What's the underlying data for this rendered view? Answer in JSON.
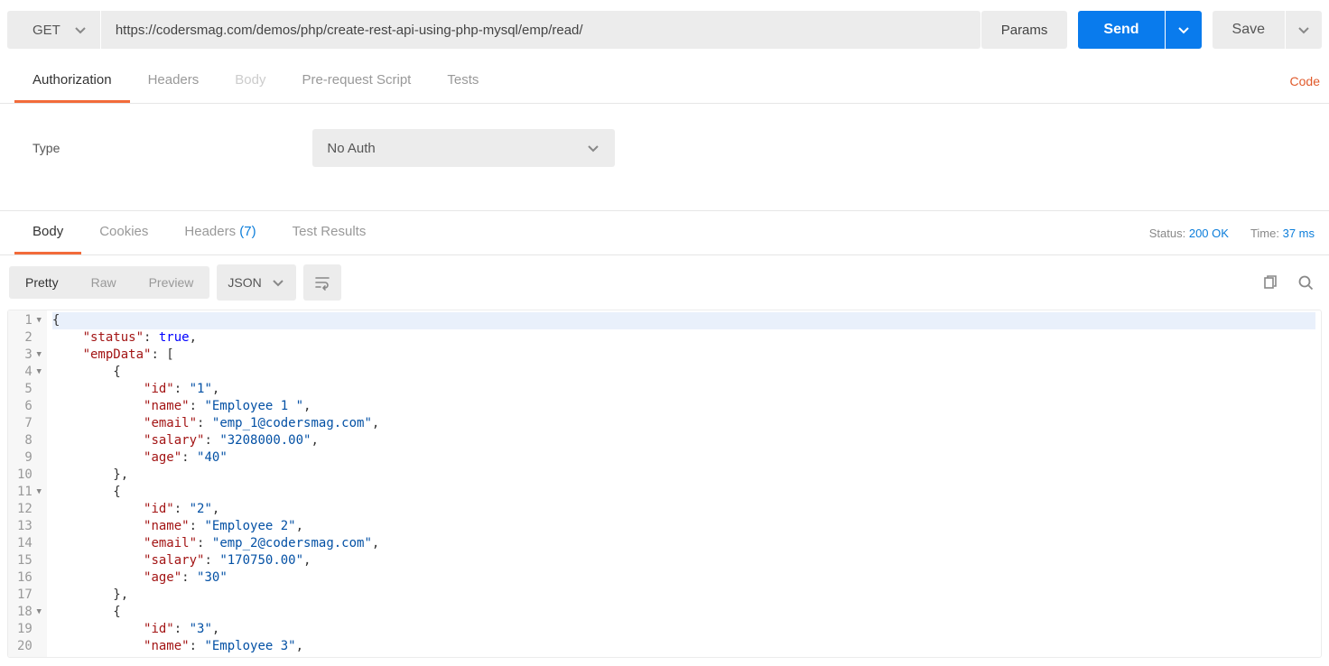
{
  "request": {
    "method": "GET",
    "url": "https://codersmag.com/demos/php/create-rest-api-using-php-mysql/emp/read/",
    "params_label": "Params",
    "send_label": "Send",
    "save_label": "Save"
  },
  "req_tabs": {
    "authorization": "Authorization",
    "headers": "Headers",
    "body": "Body",
    "prerequest": "Pre-request Script",
    "tests": "Tests"
  },
  "code_link": "Code",
  "auth": {
    "type_label": "Type",
    "value": "No Auth"
  },
  "resp_tabs": {
    "body": "Body",
    "cookies": "Cookies",
    "headers": "Headers",
    "headers_count": "(7)",
    "test_results": "Test Results"
  },
  "resp_meta": {
    "status_label": "Status:",
    "status_value": "200 OK",
    "time_label": "Time:",
    "time_value": "37 ms"
  },
  "view": {
    "pretty": "Pretty",
    "raw": "Raw",
    "preview": "Preview",
    "format": "JSON"
  },
  "code_lines": [
    {
      "n": 1,
      "fold": true,
      "hl": true,
      "tokens": [
        {
          "t": "{",
          "c": "punct"
        }
      ]
    },
    {
      "n": 2,
      "tokens": [
        {
          "t": "    ",
          "c": "p"
        },
        {
          "t": "\"status\"",
          "c": "key"
        },
        {
          "t": ": ",
          "c": "p"
        },
        {
          "t": "true",
          "c": "bool"
        },
        {
          "t": ",",
          "c": "punct"
        }
      ]
    },
    {
      "n": 3,
      "fold": true,
      "tokens": [
        {
          "t": "    ",
          "c": "p"
        },
        {
          "t": "\"empData\"",
          "c": "key"
        },
        {
          "t": ": [",
          "c": "punct"
        }
      ]
    },
    {
      "n": 4,
      "fold": true,
      "tokens": [
        {
          "t": "        {",
          "c": "punct"
        }
      ]
    },
    {
      "n": 5,
      "tokens": [
        {
          "t": "            ",
          "c": "p"
        },
        {
          "t": "\"id\"",
          "c": "key"
        },
        {
          "t": ": ",
          "c": "p"
        },
        {
          "t": "\"1\"",
          "c": "str"
        },
        {
          "t": ",",
          "c": "punct"
        }
      ]
    },
    {
      "n": 6,
      "tokens": [
        {
          "t": "            ",
          "c": "p"
        },
        {
          "t": "\"name\"",
          "c": "key"
        },
        {
          "t": ": ",
          "c": "p"
        },
        {
          "t": "\"Employee 1 \"",
          "c": "str"
        },
        {
          "t": ",",
          "c": "punct"
        }
      ]
    },
    {
      "n": 7,
      "tokens": [
        {
          "t": "            ",
          "c": "p"
        },
        {
          "t": "\"email\"",
          "c": "key"
        },
        {
          "t": ": ",
          "c": "p"
        },
        {
          "t": "\"emp_1@codersmag.com\"",
          "c": "str"
        },
        {
          "t": ",",
          "c": "punct"
        }
      ]
    },
    {
      "n": 8,
      "tokens": [
        {
          "t": "            ",
          "c": "p"
        },
        {
          "t": "\"salary\"",
          "c": "key"
        },
        {
          "t": ": ",
          "c": "p"
        },
        {
          "t": "\"3208000.00\"",
          "c": "str"
        },
        {
          "t": ",",
          "c": "punct"
        }
      ]
    },
    {
      "n": 9,
      "tokens": [
        {
          "t": "            ",
          "c": "p"
        },
        {
          "t": "\"age\"",
          "c": "key"
        },
        {
          "t": ": ",
          "c": "p"
        },
        {
          "t": "\"40\"",
          "c": "str"
        }
      ]
    },
    {
      "n": 10,
      "tokens": [
        {
          "t": "        },",
          "c": "punct"
        }
      ]
    },
    {
      "n": 11,
      "fold": true,
      "tokens": [
        {
          "t": "        {",
          "c": "punct"
        }
      ]
    },
    {
      "n": 12,
      "tokens": [
        {
          "t": "            ",
          "c": "p"
        },
        {
          "t": "\"id\"",
          "c": "key"
        },
        {
          "t": ": ",
          "c": "p"
        },
        {
          "t": "\"2\"",
          "c": "str"
        },
        {
          "t": ",",
          "c": "punct"
        }
      ]
    },
    {
      "n": 13,
      "tokens": [
        {
          "t": "            ",
          "c": "p"
        },
        {
          "t": "\"name\"",
          "c": "key"
        },
        {
          "t": ": ",
          "c": "p"
        },
        {
          "t": "\"Employee 2\"",
          "c": "str"
        },
        {
          "t": ",",
          "c": "punct"
        }
      ]
    },
    {
      "n": 14,
      "tokens": [
        {
          "t": "            ",
          "c": "p"
        },
        {
          "t": "\"email\"",
          "c": "key"
        },
        {
          "t": ": ",
          "c": "p"
        },
        {
          "t": "\"emp_2@codersmag.com\"",
          "c": "str"
        },
        {
          "t": ",",
          "c": "punct"
        }
      ]
    },
    {
      "n": 15,
      "tokens": [
        {
          "t": "            ",
          "c": "p"
        },
        {
          "t": "\"salary\"",
          "c": "key"
        },
        {
          "t": ": ",
          "c": "p"
        },
        {
          "t": "\"170750.00\"",
          "c": "str"
        },
        {
          "t": ",",
          "c": "punct"
        }
      ]
    },
    {
      "n": 16,
      "tokens": [
        {
          "t": "            ",
          "c": "p"
        },
        {
          "t": "\"age\"",
          "c": "key"
        },
        {
          "t": ": ",
          "c": "p"
        },
        {
          "t": "\"30\"",
          "c": "str"
        }
      ]
    },
    {
      "n": 17,
      "tokens": [
        {
          "t": "        },",
          "c": "punct"
        }
      ]
    },
    {
      "n": 18,
      "fold": true,
      "tokens": [
        {
          "t": "        {",
          "c": "punct"
        }
      ]
    },
    {
      "n": 19,
      "tokens": [
        {
          "t": "            ",
          "c": "p"
        },
        {
          "t": "\"id\"",
          "c": "key"
        },
        {
          "t": ": ",
          "c": "p"
        },
        {
          "t": "\"3\"",
          "c": "str"
        },
        {
          "t": ",",
          "c": "punct"
        }
      ]
    },
    {
      "n": 20,
      "tokens": [
        {
          "t": "            ",
          "c": "p"
        },
        {
          "t": "\"name\"",
          "c": "key"
        },
        {
          "t": ": ",
          "c": "p"
        },
        {
          "t": "\"Employee 3\"",
          "c": "str"
        },
        {
          "t": ",",
          "c": "punct"
        }
      ]
    }
  ]
}
